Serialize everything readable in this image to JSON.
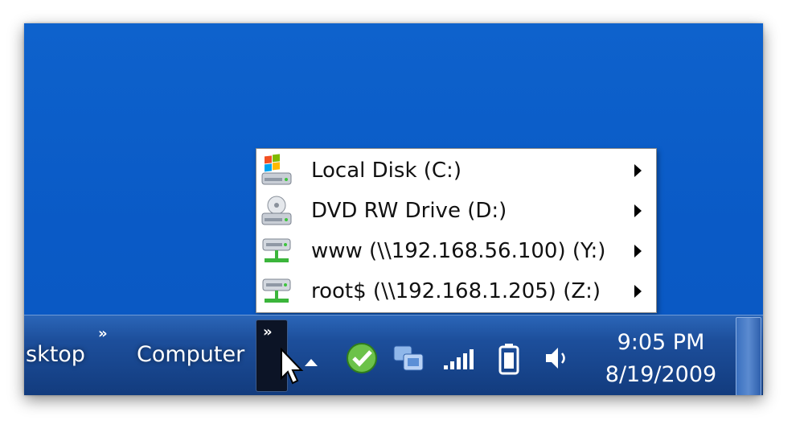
{
  "menu": {
    "items": [
      {
        "label": "Local Disk (C:)",
        "icon": "local-disk-icon"
      },
      {
        "label": "DVD RW Drive (D:)",
        "icon": "dvd-drive-icon"
      },
      {
        "label": "www (\\\\192.168.56.100) (Y:)",
        "icon": "network-drive-icon"
      },
      {
        "label": "root$ (\\\\192.168.1.205) (Z:)",
        "icon": "network-drive-icon"
      }
    ]
  },
  "taskbar": {
    "toolbar_desktop_label": "sktop",
    "toolbar_computer_label": "Computer",
    "chevron": "»"
  },
  "clock": {
    "time": "9:05 PM",
    "date": "8/19/2009"
  },
  "tray": {
    "icons": [
      "show-hidden-icons-arrow",
      "messenger-icon",
      "sync-icon",
      "network-signal-icon",
      "battery-icon",
      "volume-icon"
    ]
  },
  "colors": {
    "desktop": "#0a5ac6",
    "taskbar": "#1d4f9c",
    "menu_bg": "#ffffff"
  }
}
